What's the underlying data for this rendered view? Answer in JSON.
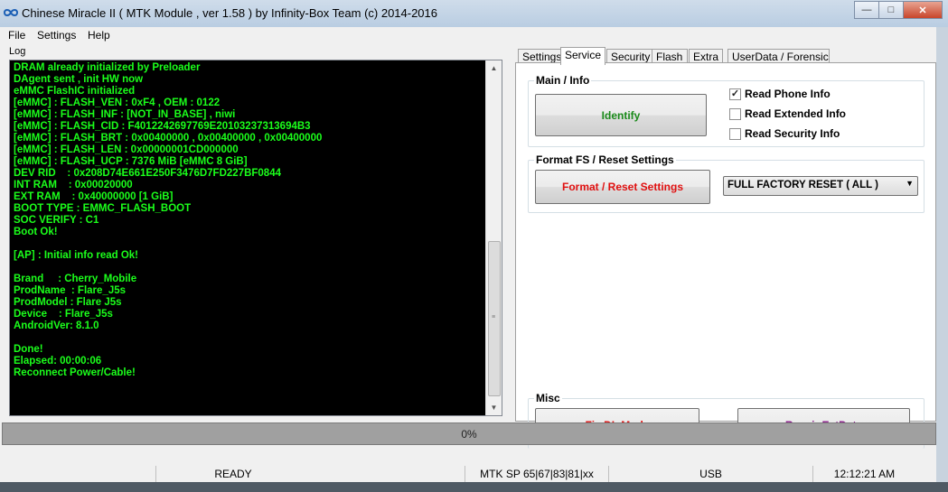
{
  "window": {
    "title": "Chinese Miracle II ( MTK Module , ver 1.58 ) by Infinity-Box Team (c) 2014-2016",
    "minimize_icon": "minimize-icon",
    "maximize_icon": "maximize-icon",
    "close_icon": "close-icon"
  },
  "menu": {
    "file": "File",
    "settings": "Settings",
    "help": "Help"
  },
  "log": {
    "label": "Log",
    "lines": [
      "DRAM already initialized by Preloader",
      "DAgent sent , init HW now",
      "eMMC FlashIC initialized",
      "[eMMC] : FLASH_VEN : 0xF4 , OEM : 0122",
      "[eMMC] : FLASH_INF : [NOT_IN_BASE] , niwi",
      "[eMMC] : FLASH_CID : F4012242697769E201032373136​94B3",
      "[eMMC] : FLASH_BRT : 0x00400000 , 0x00400000 , 0x00400000",
      "[eMMC] : FLASH_LEN : 0x00000001CD000000",
      "[eMMC] : FLASH_UCP : 7376 MiB [eMMC 8 GiB]",
      "DEV RID    : 0x208D74E661E250F3476D7FD227BF0844",
      "INT RAM    : 0x00020000",
      "EXT RAM    : 0x40000000 [1 GiB]",
      "BOOT TYPE : EMMC_FLASH_BOOT",
      "SOC VERIFY : C1",
      "Boot Ok!",
      "",
      "[AP] : Initial info read Ok!",
      "",
      "Brand     : Cherry_Mobile",
      "ProdName  : Flare_J5s",
      "ProdModel : Flare J5s",
      "Device    : Flare_J5s",
      "AndroidVer: 8.1.0",
      "",
      "Done!",
      "Elapsed: 00:00:06",
      "Reconnect Power/Cable!"
    ]
  },
  "tabs": [
    {
      "label": "Settings",
      "active": false
    },
    {
      "label": "Service",
      "active": true
    },
    {
      "label": "Security",
      "active": false
    },
    {
      "label": "Flash",
      "active": false
    },
    {
      "label": "Extra",
      "active": false
    },
    {
      "label": "UserData / Forensic",
      "active": false
    }
  ],
  "service": {
    "main_info": {
      "title": "Main / Info",
      "identify_label": "Identify",
      "identify_color": "#1a8a1a",
      "checkboxes": [
        {
          "label": "Read Phone Info",
          "checked": true
        },
        {
          "label": "Read Extended Info",
          "checked": false
        },
        {
          "label": "Read Security Info",
          "checked": false
        }
      ]
    },
    "format": {
      "title": "Format FS / Reset Settings",
      "button_label": "Format / Reset Settings",
      "button_color": "#e01010",
      "select_value": "FULL FACTORY RESET ( ALL )"
    },
    "misc": {
      "title": "Misc",
      "fix_dl_label": "Fix DL Mode",
      "fix_dl_color": "#e01010",
      "repair_label": "Repair ExtData",
      "repair_color": "#8a1a8a"
    }
  },
  "progress": {
    "text": "0%",
    "value": 0
  },
  "status": {
    "state": "READY",
    "platform": "MTK SP 65|67|83|81|xx",
    "connection": "USB",
    "time": "12:12:21 AM"
  },
  "colors": {
    "log_bg": "#000000",
    "log_text": "#1bff1b"
  }
}
